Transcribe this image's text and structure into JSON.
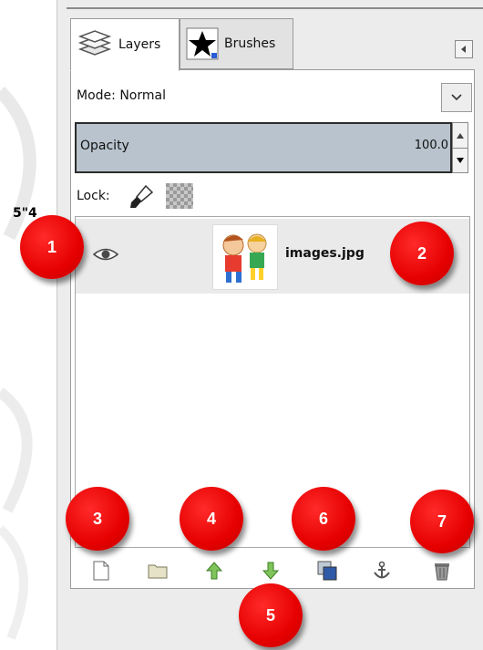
{
  "clipped_text": "5\"4",
  "tabs": [
    {
      "label": "Layers",
      "icon": "layers-icon",
      "active": true
    },
    {
      "label": "Brushes",
      "icon": "brushes-icon",
      "active": false
    }
  ],
  "mode": {
    "label": "Mode:",
    "value": "Normal"
  },
  "opacity": {
    "label": "Opacity",
    "value": "100.0"
  },
  "lock": {
    "label": "Lock:"
  },
  "layer": {
    "name": "images.jpg",
    "visible": true
  },
  "markers": [
    "1",
    "2",
    "3",
    "4",
    "5",
    "6",
    "7"
  ],
  "colors": {
    "marker_red": "#e60000",
    "opacity_bar": "#b8c3cd",
    "panel_bg": "#ececec"
  }
}
